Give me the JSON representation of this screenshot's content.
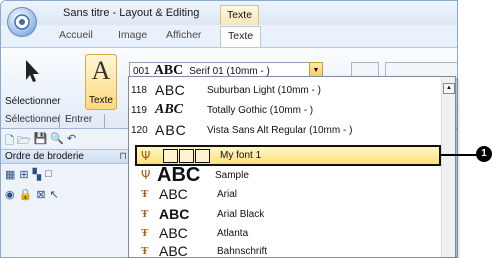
{
  "window": {
    "title": "Sans titre - Layout & Editing",
    "context_tab": "Texte"
  },
  "tabs": [
    {
      "label": "Accueil"
    },
    {
      "label": "Image"
    },
    {
      "label": "Afficher"
    },
    {
      "label": "Texte"
    }
  ],
  "ribbon": {
    "select_label": "Sélectionner",
    "text_label": "Texte",
    "group_select": "Sélectionner",
    "group_enter": "Entrer",
    "font_combo": {
      "number": "001",
      "sample": "ABC",
      "name": "Serif 01  (10mm - )"
    }
  },
  "left_panel": {
    "header": "Ordre de broderie",
    "pin": "⊓"
  },
  "font_list": [
    {
      "number": "118",
      "sample": "ABC",
      "name": "Suburban Light  (10mm - )"
    },
    {
      "number": "119",
      "sample": "ABC",
      "name": "Totally Gothic  (10mm - )"
    },
    {
      "number": "120",
      "sample": "ABC",
      "name": "Vista Sans Alt Regular  (10mm - )"
    }
  ],
  "selected_font": {
    "icon": "Ψ",
    "name": "My font 1"
  },
  "sample_font": {
    "icon": "Ψ",
    "sample": "ABC",
    "name": "Sample"
  },
  "truetype_fonts": [
    {
      "icon": "Ŧ",
      "sample": "ABC",
      "name": "Arial",
      "bold": false
    },
    {
      "icon": "Ŧ",
      "sample": "ABC",
      "name": "Arial Black",
      "bold": true
    },
    {
      "icon": "Ŧ",
      "sample": "ABC",
      "name": "Atlanta",
      "bold": false
    },
    {
      "icon": "Ŧ",
      "sample": "ABC",
      "name": "Bahnschrift",
      "bold": false
    }
  ],
  "callout": "1",
  "colors": {
    "selection_fill": "#ffe27a",
    "accent": "#f7c65a",
    "frame": "#8aa9cf"
  }
}
